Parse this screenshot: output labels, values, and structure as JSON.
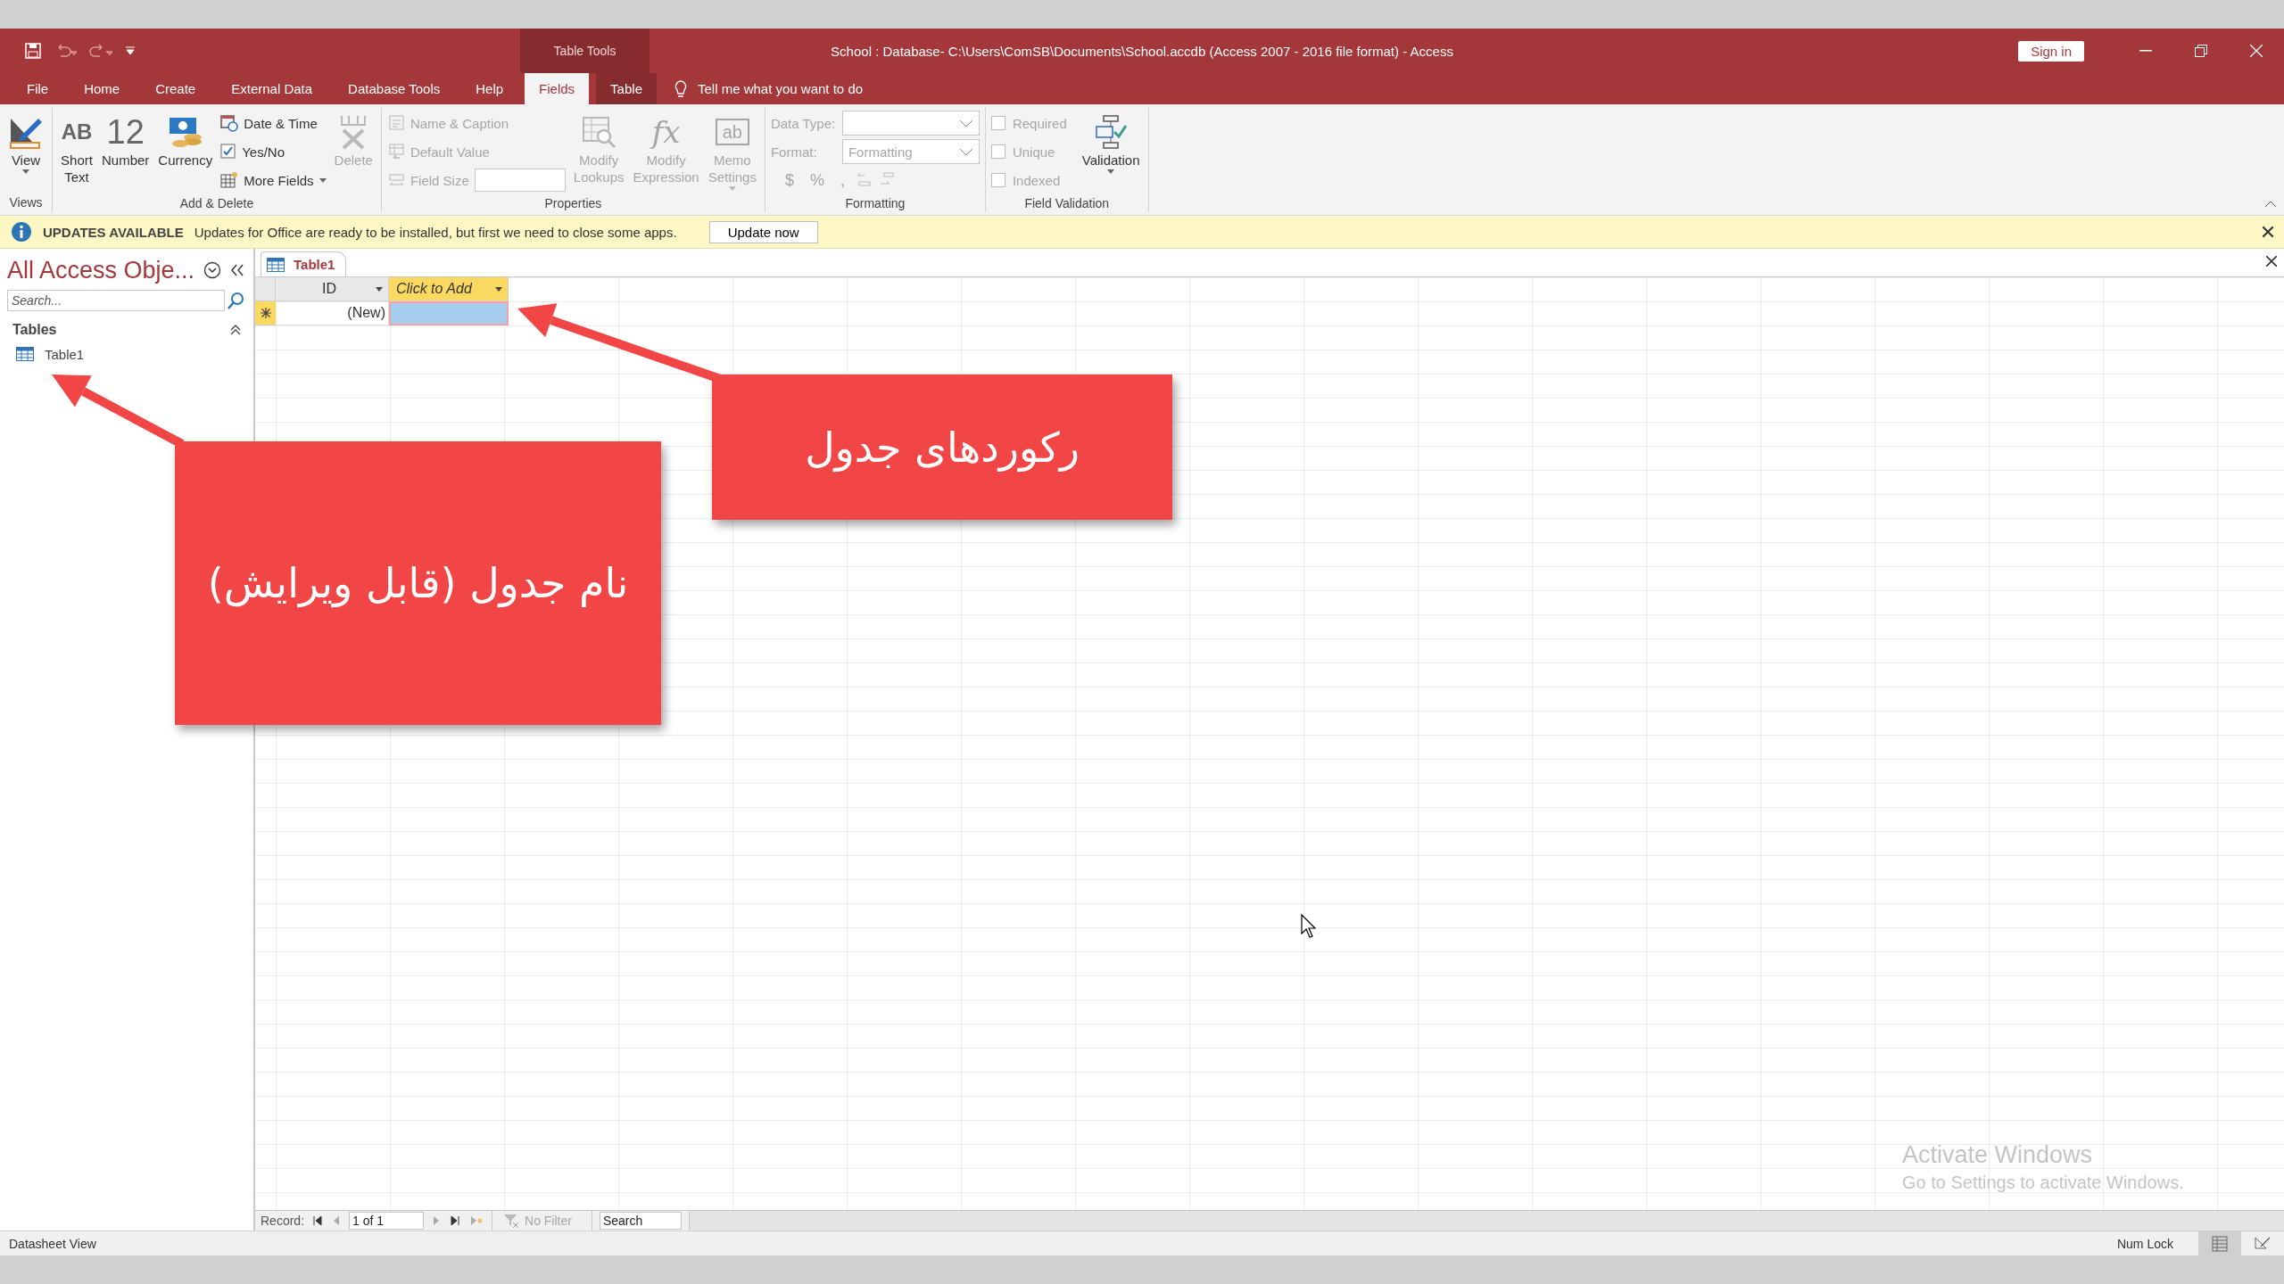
{
  "window": {
    "context_group": "Table Tools",
    "title": "School : Database- C:\\Users\\ComSB\\Documents\\School.accdb (Access 2007 - 2016 file format)  -  Access",
    "sign_in": "Sign in"
  },
  "tabs": [
    {
      "label": "File",
      "selected": false,
      "contextual": false
    },
    {
      "label": "Home",
      "selected": false,
      "contextual": false
    },
    {
      "label": "Create",
      "selected": false,
      "contextual": false
    },
    {
      "label": "External Data",
      "selected": false,
      "contextual": false
    },
    {
      "label": "Database Tools",
      "selected": false,
      "contextual": false
    },
    {
      "label": "Help",
      "selected": false,
      "contextual": false
    },
    {
      "label": "Fields",
      "selected": true,
      "contextual": true
    },
    {
      "label": "Table",
      "selected": false,
      "contextual": true
    }
  ],
  "tell_me": "Tell me what you want to do",
  "ribbon": [
    {
      "label": "Views",
      "columns": [
        [
          {
            "kind": "large",
            "label": "View",
            "dropdown": true,
            "disabled": false
          }
        ]
      ]
    },
    {
      "label": "Add & Delete",
      "columns": [
        [
          {
            "kind": "large",
            "label": "Short Text",
            "glyph": "AB",
            "disabled": false
          }
        ],
        [
          {
            "kind": "large",
            "label": "Number",
            "glyph": "12",
            "disabled": false
          }
        ],
        [
          {
            "kind": "large",
            "label": "Currency",
            "disabled": false
          }
        ],
        [
          {
            "kind": "small",
            "label": "Date & Time",
            "disabled": false
          },
          {
            "kind": "small",
            "label": "Yes/No",
            "disabled": false
          },
          {
            "kind": "small",
            "label": "More Fields",
            "dropdown": true,
            "disabled": false
          }
        ],
        [
          {
            "kind": "large",
            "label": "Delete",
            "disabled": true
          }
        ]
      ]
    },
    {
      "label": "Properties",
      "columns": [
        [
          {
            "kind": "small",
            "label": "Name & Caption",
            "disabled": true
          },
          {
            "kind": "small",
            "label": "Default Value",
            "disabled": true
          },
          {
            "kind": "field",
            "label": "Field Size",
            "disabled": true
          }
        ],
        [
          {
            "kind": "large",
            "label": "Modify Lookups",
            "disabled": true
          }
        ],
        [
          {
            "kind": "large",
            "label": "Modify Expression",
            "glyph": "fx",
            "disabled": true
          }
        ],
        [
          {
            "kind": "large",
            "label": "Memo Settings",
            "glyph": "ab",
            "dropdown": true,
            "disabled": true
          }
        ]
      ]
    },
    {
      "label": "Formatting",
      "columns": [
        [
          {
            "kind": "select",
            "label": "Data Type:",
            "disabled": true
          },
          {
            "kind": "select",
            "label": "Format:",
            "value": "Formatting",
            "disabled": true
          },
          {
            "kind": "symbols",
            "symbols": [
              "$",
              "%",
              ","
            ],
            "disabled": true
          }
        ]
      ]
    },
    {
      "label": "Field Validation",
      "columns": [
        [
          {
            "kind": "checkbox",
            "label": "Required",
            "checked": false,
            "disabled": true
          },
          {
            "kind": "checkbox",
            "label": "Unique",
            "checked": false,
            "disabled": true
          },
          {
            "kind": "checkbox",
            "label": "Indexed",
            "checked": false,
            "disabled": true
          }
        ],
        [
          {
            "kind": "large",
            "label": "Validation",
            "dropdown": true,
            "disabled": false
          }
        ]
      ]
    }
  ],
  "update_bar": {
    "title": "UPDATES AVAILABLE",
    "message": "Updates for Office are ready to be installed, but first we need to close some apps.",
    "button": "Update now"
  },
  "nav_pane": {
    "title": "All Access Obje...",
    "search_placeholder": "Search...",
    "sections": [
      {
        "label": "Tables",
        "expanded": true,
        "items": [
          {
            "label": "Table1",
            "selected": false
          }
        ]
      }
    ]
  },
  "document_tabs": [
    {
      "label": "Table1",
      "selected": true
    }
  ],
  "datasheet": {
    "columns": [
      {
        "label": "ID",
        "kind": "field"
      },
      {
        "label": "Click to Add",
        "kind": "add"
      }
    ],
    "rows": [
      {
        "new": true,
        "cells": [
          "(New)"
        ]
      }
    ]
  },
  "record_nav": {
    "label": "Record:",
    "position": "1 of 1",
    "filter": "No Filter",
    "search_placeholder": "Search"
  },
  "status_bar": {
    "text": "Datasheet View",
    "num_lock": "Num Lock"
  },
  "activation": {
    "title": "Activate Windows",
    "message": "Go to Settings to activate Windows."
  },
  "callouts": [
    {
      "text": "رکوردهای جدول"
    },
    {
      "text": "نام جدول (قابل ویرایش)"
    }
  ]
}
